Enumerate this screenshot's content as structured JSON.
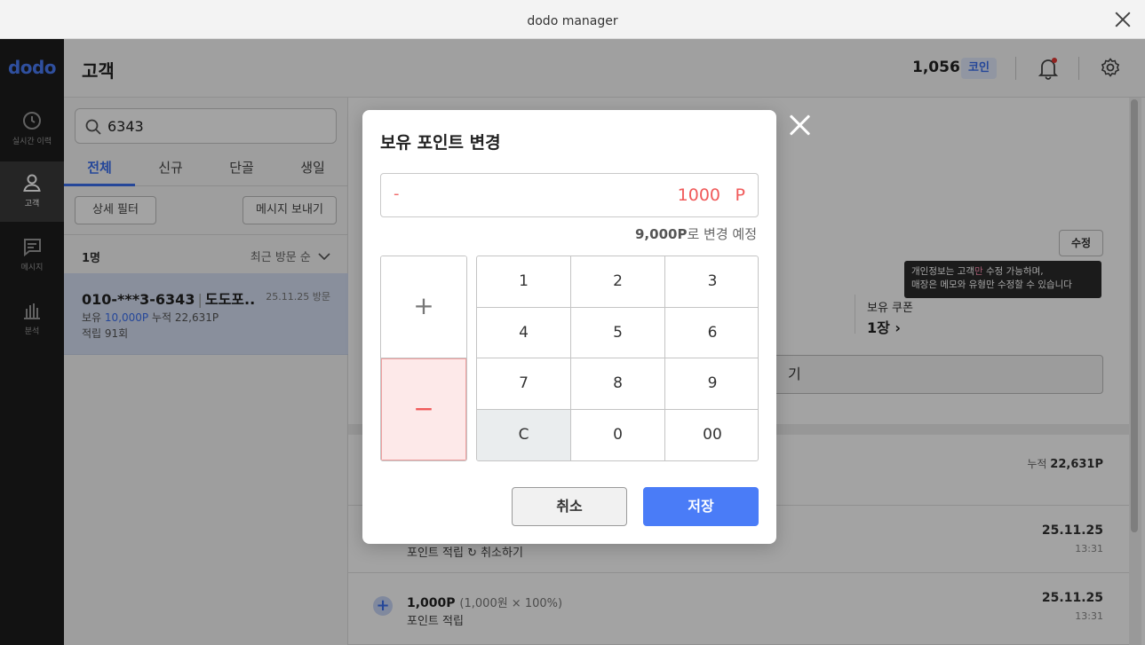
{
  "window": {
    "title": "dodo manager"
  },
  "rail": {
    "logo": "dodo",
    "items": [
      {
        "label": "실시간 이력",
        "icon": "clock-icon"
      },
      {
        "label": "고객",
        "icon": "person-icon"
      },
      {
        "label": "메시지",
        "icon": "message-icon"
      },
      {
        "label": "분석",
        "icon": "chart-icon"
      }
    ]
  },
  "header": {
    "title": "고객",
    "coins": "1,056",
    "coin_label": "코인"
  },
  "list": {
    "search_value": "6343",
    "tabs": [
      "전체",
      "신규",
      "단골",
      "생일"
    ],
    "filter_button": "상세 필터",
    "message_button": "메시지 보내기",
    "count": "1명",
    "sort": "최근 방문 순",
    "customer": {
      "phone": "010-***3-6343",
      "name": "도도포..",
      "visit": "25.11.25 방문",
      "points_label": "보유",
      "points": "10,000P",
      "accum": "누적 22,631P",
      "count": "적립 91회"
    }
  },
  "detail": {
    "edit_button": "수정",
    "tooltip_pre": "개인정보는 고객",
    "tooltip_highlight": "만",
    "tooltip_post": " 수정 가능하며,",
    "tooltip_line2": "매장은 메모와 유형만 수정할 수 있습니다",
    "coupon_label": "보유 쿠폰",
    "coupon_value": "1장 ›",
    "big_button_tail": "기",
    "accum_label": "누적",
    "accum_value": "22,631P",
    "history": [
      {
        "amount": "",
        "amount_sub": "",
        "desc": "포인트 적립 ↻ 취소하기",
        "date": "25.11.25",
        "time": "13:31"
      },
      {
        "amount": "1,000P",
        "amount_sub": "(1,000원 × 100%)",
        "desc": "포인트 적립",
        "date": "25.11.25",
        "time": "13:31"
      }
    ]
  },
  "modal": {
    "title": "보유 포인트 변경",
    "sign": "-",
    "amount": "1000",
    "unit": "P",
    "preview_value": "9,000P",
    "preview_suffix": "로 변경 예정",
    "plus": "+",
    "minus": "−",
    "keys": [
      "1",
      "2",
      "3",
      "4",
      "5",
      "6",
      "7",
      "8",
      "9",
      "C",
      "0",
      "00"
    ],
    "cancel": "취소",
    "save": "저장"
  },
  "colors": {
    "accent": "#4a7cf7",
    "negative": "#f05a5a",
    "rail": "#1d1d1d"
  }
}
